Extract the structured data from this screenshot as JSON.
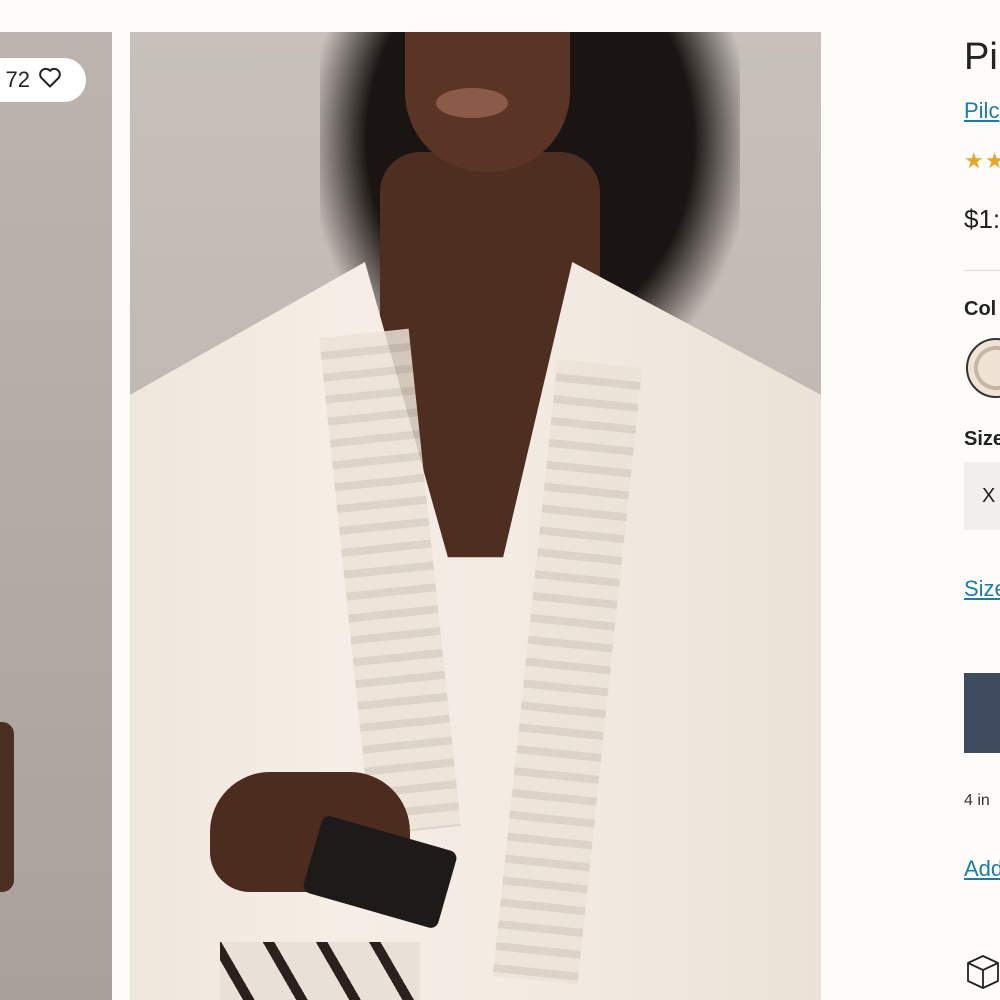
{
  "gallery": {
    "like_count": "72",
    "icons": {
      "like": "heart-icon"
    }
  },
  "product": {
    "title": "Pi",
    "brand": "Pilc",
    "rating_stars": "★★",
    "price": "$1:",
    "color_label": "Col",
    "size_label": "Size",
    "size_option": "X",
    "size_guide_link": "Size",
    "installments_text": "4 in",
    "wishlist_link": "Add",
    "icons": {
      "shipping": "box-icon"
    }
  },
  "colors": {
    "link": "#1b7da6",
    "star": "#e3a82b",
    "cta": "#3f4c5f",
    "background": "#fdfcf8"
  }
}
